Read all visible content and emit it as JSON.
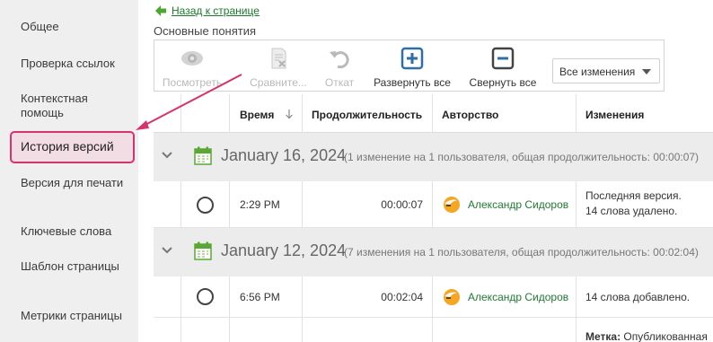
{
  "sidebar": {
    "items": [
      {
        "label": "Общее"
      },
      {
        "label": "Проверка ссылок"
      },
      {
        "label": "Контекстная помощь"
      },
      {
        "label": "История версий"
      },
      {
        "label": "Версия для печати"
      },
      {
        "label": "Ключевые слова"
      },
      {
        "label": "Шаблон страницы"
      },
      {
        "label": "Метрики страницы"
      }
    ],
    "active_index": 3
  },
  "back_link": {
    "label": "Назад к странице"
  },
  "section_title": "Основные понятия",
  "toolbar": {
    "view": "Посмотреть",
    "compare": "Сравните...",
    "revert": "Откат",
    "expand_all": "Развернуть все",
    "collapse_all": "Свернуть все",
    "filter_value": "Все изменения"
  },
  "table": {
    "headers": {
      "time": "Время",
      "duration": "Продолжительность",
      "author": "Авторство",
      "changes": "Изменения"
    },
    "groups": [
      {
        "date": "January 16, 2024",
        "summary": "(1 изменение на 1 пользователя, общая продолжительность: 00:00:07)",
        "rows": [
          {
            "time": "2:29 PM",
            "duration": "00:00:07",
            "author": "Александр Сидоров",
            "changes_line1": "Последняя версия.",
            "changes_line2": "14 слова удалено."
          }
        ]
      },
      {
        "date": "January 12, 2024",
        "summary": "(7 изменения на 1 пользователя, общая продолжительность: 00:02:04)",
        "rows": [
          {
            "time": "6:56 PM",
            "duration": "00:02:04",
            "author": "Александр Сидоров",
            "changes_line1": "14 слова добавлено."
          },
          {
            "tag_label": "Метка:",
            "tag_value": "Опубликованная"
          }
        ]
      }
    ]
  },
  "colors": {
    "highlight_border": "#d6336c",
    "highlight_bg": "#f3dde5",
    "link_green": "#1a7a2a",
    "icon_blue": "#2e6fa8",
    "group_bg": "#ececec",
    "calendar_green": "#5aa832",
    "avatar_orange": "#f5a623"
  },
  "icons": {
    "back": "green-left-arrow-icon",
    "view": "eye-icon",
    "compare": "compare-document-icon",
    "revert": "undo-icon",
    "expand": "plus-square-icon",
    "collapse": "minus-square-icon",
    "group_toggle": "chevron-down-icon",
    "group_date": "calendar-icon",
    "author": "avatar-icon"
  }
}
